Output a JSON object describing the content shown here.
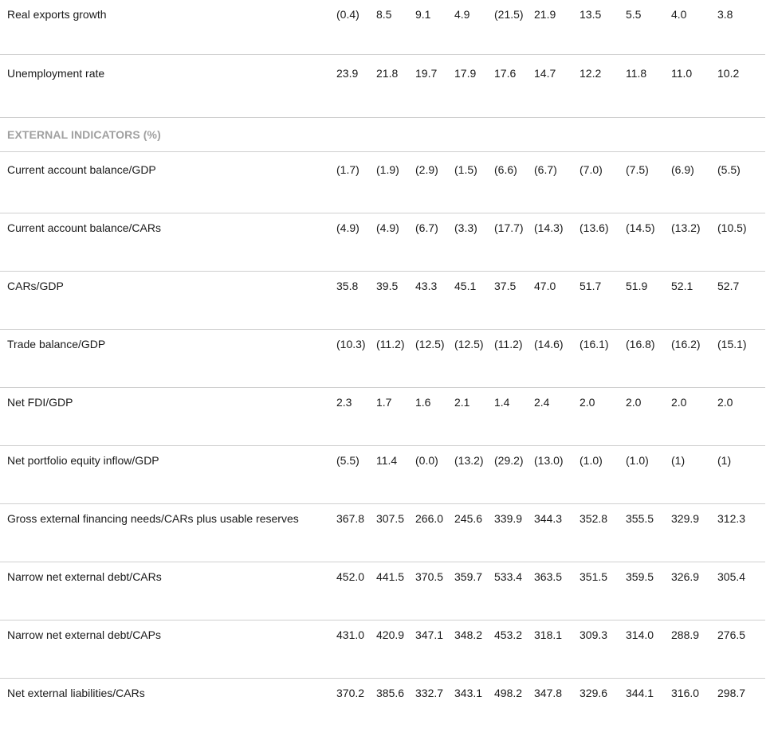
{
  "rows_top": [
    {
      "label": "Real exports growth",
      "values": [
        "(0.4)",
        "8.5",
        "9.1",
        "4.9",
        "(21.5)",
        "21.9",
        "13.5",
        "5.5",
        "4.0",
        "3.8"
      ]
    },
    {
      "label": "Unemployment rate",
      "values": [
        "23.9",
        "21.8",
        "19.7",
        "17.9",
        "17.6",
        "14.7",
        "12.2",
        "11.8",
        "11.0",
        "10.2"
      ]
    }
  ],
  "section": {
    "title": "EXTERNAL INDICATORS (%)"
  },
  "rows_external": [
    {
      "label": "Current account balance/GDP",
      "values": [
        "(1.7)",
        "(1.9)",
        "(2.9)",
        "(1.5)",
        "(6.6)",
        "(6.7)",
        "(7.0)",
        "(7.5)",
        "(6.9)",
        "(5.5)"
      ]
    },
    {
      "label": "Current account balance/CARs",
      "values": [
        "(4.9)",
        "(4.9)",
        "(6.7)",
        "(3.3)",
        "(17.7)",
        "(14.3)",
        "(13.6)",
        "(14.5)",
        "(13.2)",
        "(10.5)"
      ]
    },
    {
      "label": "CARs/GDP",
      "values": [
        "35.8",
        "39.5",
        "43.3",
        "45.1",
        "37.5",
        "47.0",
        "51.7",
        "51.9",
        "52.1",
        "52.7"
      ]
    },
    {
      "label": "Trade balance/GDP",
      "values": [
        "(10.3)",
        "(11.2)",
        "(12.5)",
        "(12.5)",
        "(11.2)",
        "(14.6)",
        "(16.1)",
        "(16.8)",
        "(16.2)",
        "(15.1)"
      ]
    },
    {
      "label": "Net FDI/GDP",
      "values": [
        "2.3",
        "1.7",
        "1.6",
        "2.1",
        "1.4",
        "2.4",
        "2.0",
        "2.0",
        "2.0",
        "2.0"
      ]
    },
    {
      "label": "Net portfolio equity inflow/GDP",
      "values": [
        "(5.5)",
        "11.4",
        "(0.0)",
        "(13.2)",
        "(29.2)",
        "(13.0)",
        "(1.0)",
        "(1.0)",
        "(1)",
        "(1)"
      ]
    },
    {
      "label": "Gross external financing needs/CARs plus usable reserves",
      "values": [
        "367.8",
        "307.5",
        "266.0",
        "245.6",
        "339.9",
        "344.3",
        "352.8",
        "355.5",
        "329.9",
        "312.3"
      ]
    },
    {
      "label": "Narrow net external debt/CARs",
      "values": [
        "452.0",
        "441.5",
        "370.5",
        "359.7",
        "533.4",
        "363.5",
        "351.5",
        "359.5",
        "326.9",
        "305.4"
      ]
    },
    {
      "label": "Narrow net external debt/CAPs",
      "values": [
        "431.0",
        "420.9",
        "347.1",
        "348.2",
        "453.2",
        "318.1",
        "309.3",
        "314.0",
        "288.9",
        "276.5"
      ]
    },
    {
      "label": "Net external liabilities/CARs",
      "values": [
        "370.2",
        "385.6",
        "332.7",
        "343.1",
        "498.2",
        "347.8",
        "329.6",
        "344.1",
        "316.0",
        "298.7"
      ]
    }
  ]
}
